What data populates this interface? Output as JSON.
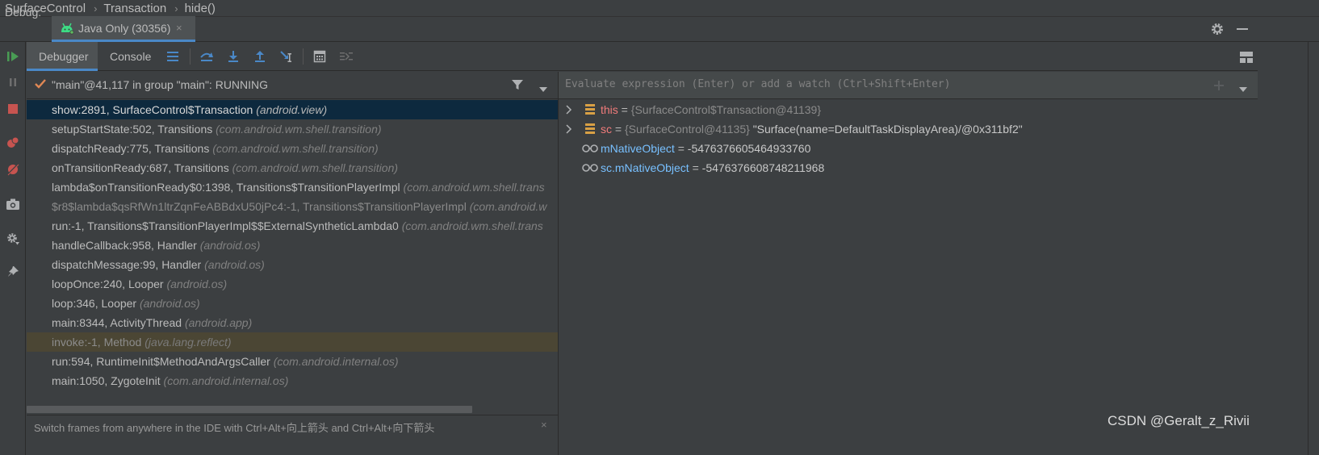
{
  "breadcrumb": [
    "SurfaceControl",
    "Transaction",
    "hide()"
  ],
  "debug_bar": {
    "label": "Debug:",
    "session": "Java Only (30356)",
    "close": "×"
  },
  "tabs": [
    {
      "label": "Debugger"
    },
    {
      "label": "Console"
    }
  ],
  "thread": {
    "label": "\"main\"@41,117 in group \"main\": RUNNING"
  },
  "frames": [
    {
      "method": "show:2891, SurfaceControl$Transaction",
      "pkg": "(android.view)",
      "state": "selected"
    },
    {
      "method": "setupStartState:502, Transitions",
      "pkg": "(com.android.wm.shell.transition)",
      "state": "normal"
    },
    {
      "method": "dispatchReady:775, Transitions",
      "pkg": "(com.android.wm.shell.transition)",
      "state": "normal"
    },
    {
      "method": "onTransitionReady:687, Transitions",
      "pkg": "(com.android.wm.shell.transition)",
      "state": "normal"
    },
    {
      "method": "lambda$onTransitionReady$0:1398, Transitions$TransitionPlayerImpl",
      "pkg": "(com.android.wm.shell.trans",
      "state": "normal"
    },
    {
      "method": "$r8$lambda$qsRfWn1ltrZqnFeABBdxU50jPc4:-1, Transitions$TransitionPlayerImpl",
      "pkg": "(com.android.w",
      "state": "synthetic"
    },
    {
      "method": "run:-1, Transitions$TransitionPlayerImpl$$ExternalSyntheticLambda0",
      "pkg": "(com.android.wm.shell.trans",
      "state": "normal"
    },
    {
      "method": "handleCallback:958, Handler",
      "pkg": "(android.os)",
      "state": "normal"
    },
    {
      "method": "dispatchMessage:99, Handler",
      "pkg": "(android.os)",
      "state": "normal"
    },
    {
      "method": "loopOnce:240, Looper",
      "pkg": "(android.os)",
      "state": "normal"
    },
    {
      "method": "loop:346, Looper",
      "pkg": "(android.os)",
      "state": "normal"
    },
    {
      "method": "main:8344, ActivityThread",
      "pkg": "(android.app)",
      "state": "normal"
    },
    {
      "method": "invoke:-1, Method",
      "pkg": "(java.lang.reflect)",
      "state": "library"
    },
    {
      "method": "run:594, RuntimeInit$MethodAndArgsCaller",
      "pkg": "(com.android.internal.os)",
      "state": "normal"
    },
    {
      "method": "main:1050, ZygoteInit",
      "pkg": "(com.android.internal.os)",
      "state": "normal"
    }
  ],
  "frames_hint": {
    "text": "Switch frames from anywhere in the IDE with Ctrl+Alt+向上箭头 and Ctrl+Alt+向下箭头",
    "close": "×"
  },
  "evaluate": {
    "placeholder": "Evaluate expression (Enter) or add a watch (Ctrl+Shift+Enter)"
  },
  "variables": [
    {
      "name": "this",
      "eq": " = ",
      "type": "{SurfaceControl$Transaction@41139}",
      "value": "",
      "expandable": true,
      "kind": "field"
    },
    {
      "name": "sc",
      "eq": " = ",
      "type": "{SurfaceControl@41135}",
      "value": " \"Surface(name=DefaultTaskDisplayArea)/@0x311bf2\"",
      "expandable": true,
      "kind": "field"
    },
    {
      "name": "mNativeObject",
      "eq": " = ",
      "type": "",
      "value": "-5476376605464933760",
      "expandable": false,
      "kind": "watch"
    },
    {
      "name": "sc.mNativeObject",
      "eq": " = ",
      "type": "",
      "value": "-5476376608748211968",
      "expandable": false,
      "kind": "watch"
    }
  ],
  "watermark": "CSDN @Geralt_z_Rivii",
  "colors": {
    "background": "#3c3f41",
    "selection": "#0d293e",
    "accent": "#4a88c7",
    "var_name": "#f07b7b",
    "resume_green": "#499c54",
    "stop_red": "#c75450"
  }
}
